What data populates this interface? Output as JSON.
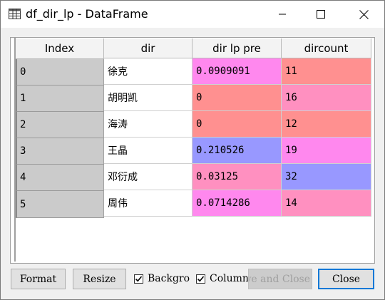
{
  "window": {
    "title": "df_dir_lp - DataFrame",
    "icon": "grid-table-icon",
    "controls": [
      "minimize-icon",
      "maximize-icon",
      "close-icon"
    ]
  },
  "table": {
    "index_header": "Index",
    "columns": [
      "dir",
      "dir lp pre",
      "dircount"
    ],
    "rows": [
      {
        "index": "0",
        "dir": "徐克",
        "dir_lp_pre": "0.0909091",
        "dircount": "11"
      },
      {
        "index": "1",
        "dir": "胡明凯",
        "dir_lp_pre": "0",
        "dircount": "16"
      },
      {
        "index": "2",
        "dir": "海涛",
        "dir_lp_pre": "0",
        "dircount": "12"
      },
      {
        "index": "3",
        "dir": "王晶",
        "dir_lp_pre": "0.210526",
        "dircount": "19"
      },
      {
        "index": "4",
        "dir": "邓衍成",
        "dir_lp_pre": "0.03125",
        "dircount": "32"
      },
      {
        "index": "5",
        "dir": "周伟",
        "dir_lp_pre": "0.0714286",
        "dircount": "14"
      }
    ],
    "colors": {
      "lp_pre": [
        "#ff88ee",
        "#ff9090",
        "#ff9090",
        "#9898ff",
        "#ff90c0",
        "#ff88ee"
      ],
      "dircount": [
        "#ff9090",
        "#ff90c0",
        "#ff9090",
        "#ff88ee",
        "#9898ff",
        "#ff90c0"
      ]
    }
  },
  "buttons": {
    "format": "Format",
    "resize": "Resize",
    "save_close": "Save and Close",
    "close": "Close"
  },
  "checkboxes": {
    "background": {
      "label": "Background color",
      "checked": true
    },
    "column": {
      "label": "Column min/max",
      "checked": true
    }
  }
}
